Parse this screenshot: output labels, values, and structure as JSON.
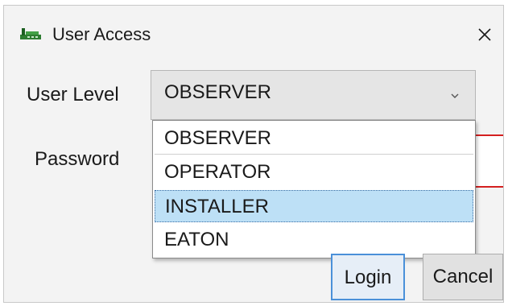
{
  "window": {
    "title": "User Access",
    "app_icon": "app-icon",
    "close_icon": "close-icon"
  },
  "form": {
    "user_level_label": "User Level",
    "password_label": "Password",
    "password_value": ""
  },
  "user_level_select": {
    "selected_value": "OBSERVER",
    "arrow_icon": "chevron-down-icon",
    "options": [
      "OBSERVER",
      "OPERATOR",
      "INSTALLER",
      "EATON"
    ],
    "highlighted_option": "INSTALLER"
  },
  "buttons": {
    "login_label": "Login",
    "cancel_label": "Cancel"
  },
  "colors": {
    "highlight": "#bde0f6",
    "error_border": "#d42020",
    "focus_border": "#4a90d9"
  }
}
